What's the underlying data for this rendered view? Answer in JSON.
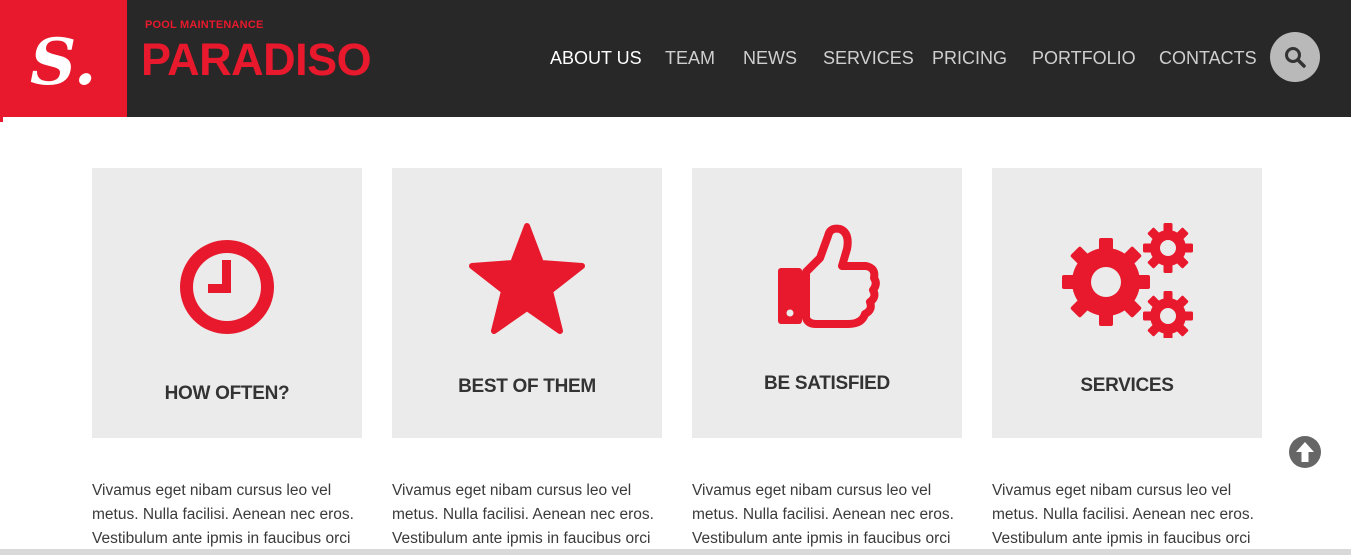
{
  "header": {
    "logo_letter": "S.",
    "brand_subtitle": "POOL MAINTENANCE",
    "brand_name": "PARADISO",
    "nav": [
      {
        "label": "ABOUT US",
        "active": true
      },
      {
        "label": "TEAM",
        "active": false
      },
      {
        "label": "NEWS",
        "active": false
      },
      {
        "label": "SERVICES",
        "active": false
      },
      {
        "label": "PRICING",
        "active": false
      },
      {
        "label": "PORTFOLIO",
        "active": false
      },
      {
        "label": "CONTACTS",
        "active": false
      }
    ],
    "search_icon": "search-icon"
  },
  "features": [
    {
      "icon": "clock-icon",
      "title": "HOW OFTEN?",
      "text_lines": [
        "Vivamus eget nibam cursus leo vel",
        "metus. Nulla facilisi. Aenean nec eros.",
        "Vestibulum ante ipmis in faucibus orci"
      ]
    },
    {
      "icon": "star-icon",
      "title": "BEST OF THEM",
      "text_lines": [
        "Vivamus eget nibam cursus leo vel",
        "metus. Nulla facilisi. Aenean nec eros.",
        "Vestibulum ante ipmis in faucibus orci"
      ]
    },
    {
      "icon": "thumbs-up-icon",
      "title": "BE SATISFIED",
      "text_lines": [
        "Vivamus eget nibam cursus leo vel",
        "metus. Nulla facilisi. Aenean nec eros.",
        "Vestibulum ante ipmis in faucibus orci"
      ]
    },
    {
      "icon": "gears-icon",
      "title": "SERVICES",
      "text_lines": [
        "Vivamus eget nibam cursus leo vel",
        "metus. Nulla facilisi. Aenean nec eros.",
        "Vestibulum ante ipmis in faucibus orci"
      ]
    }
  ],
  "scroll_top_icon": "arrow-up-circle-icon",
  "colors": {
    "accent": "#e8192c",
    "header_bg": "#282828",
    "card_bg": "#ebebeb"
  }
}
